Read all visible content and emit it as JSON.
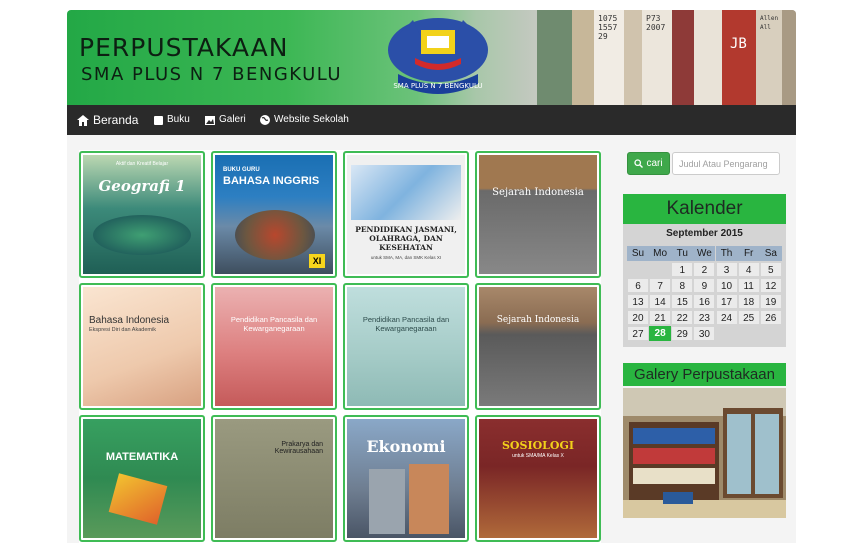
{
  "banner": {
    "title_line1": "PERPUSTAKAAN",
    "title_line2": "SMA PLUS N 7 BENGKULU",
    "logo_text": "SMA PLUS N 7 BENGKULU",
    "spine_labels": [
      "1075\n1557\n29",
      "P73\n2007",
      "JB",
      "Allen\nAll"
    ]
  },
  "nav": {
    "home": "Beranda",
    "items": [
      {
        "label": "Buku",
        "icon": "book-icon"
      },
      {
        "label": "Galeri",
        "icon": "image-icon"
      },
      {
        "label": "Website Sekolah",
        "icon": "globe-icon"
      }
    ]
  },
  "books": [
    {
      "title": "Geografi 1",
      "subtitle": "Aktif dan Kreatif Belajar",
      "bg": "#1f6f7a"
    },
    {
      "title": "BAHASA INGGRIS",
      "subtitle": "BUKU GURU",
      "bg": "#1a6fb3"
    },
    {
      "title": "PENDIDIKAN JASMANI, OLAHRAGA, DAN KESEHATAN",
      "subtitle": "untuk SMA, MA, dan SMK Kelas XI",
      "bg": "#e8e8e8"
    },
    {
      "title": "Sejarah Indonesia",
      "subtitle": "",
      "bg": "#9e7b55"
    },
    {
      "title": "Bahasa Indonesia",
      "subtitle": "Ekspresi Diri dan Akademik",
      "bg": "#f2d7bf"
    },
    {
      "title": "Pendidikan Pancasila dan Kewarganegaraan",
      "subtitle": "",
      "bg": "#e9a6a6"
    },
    {
      "title": "Pendidikan Pancasila dan Kewarganegaraan",
      "subtitle": "",
      "bg": "#a8ccc8"
    },
    {
      "title": "Sejarah Indonesia",
      "subtitle": "",
      "bg": "#8a6c52"
    },
    {
      "title": "MATEMATIKA",
      "subtitle": "",
      "bg": "#2f8a52"
    },
    {
      "title": "Prakarya dan Kewirausahaan",
      "subtitle": "",
      "bg": "#8a8a6c"
    },
    {
      "title": "Ekonomi",
      "subtitle": "",
      "bg": "#6e7d90"
    },
    {
      "title": "SOSIOLOGI",
      "subtitle": "untuk SMA/MA Kelas X",
      "bg": "#7a2626"
    }
  ],
  "search": {
    "button": "cari",
    "placeholder": "Judul Atau Pengarang"
  },
  "calendar": {
    "heading": "Kalender",
    "month": "September 2015",
    "days": [
      "Su",
      "Mo",
      "Tu",
      "We",
      "Th",
      "Fr",
      "Sa"
    ],
    "weeks": [
      [
        "",
        "",
        "1",
        "2",
        "3",
        "4",
        "5"
      ],
      [
        "6",
        "7",
        "8",
        "9",
        "10",
        "11",
        "12"
      ],
      [
        "13",
        "14",
        "15",
        "16",
        "17",
        "18",
        "19"
      ],
      [
        "20",
        "21",
        "22",
        "23",
        "24",
        "25",
        "26"
      ],
      [
        "27",
        "28",
        "29",
        "30",
        "",
        "",
        ""
      ]
    ],
    "today": "28"
  },
  "gallery": {
    "heading": "Galery Perpustakaan"
  }
}
